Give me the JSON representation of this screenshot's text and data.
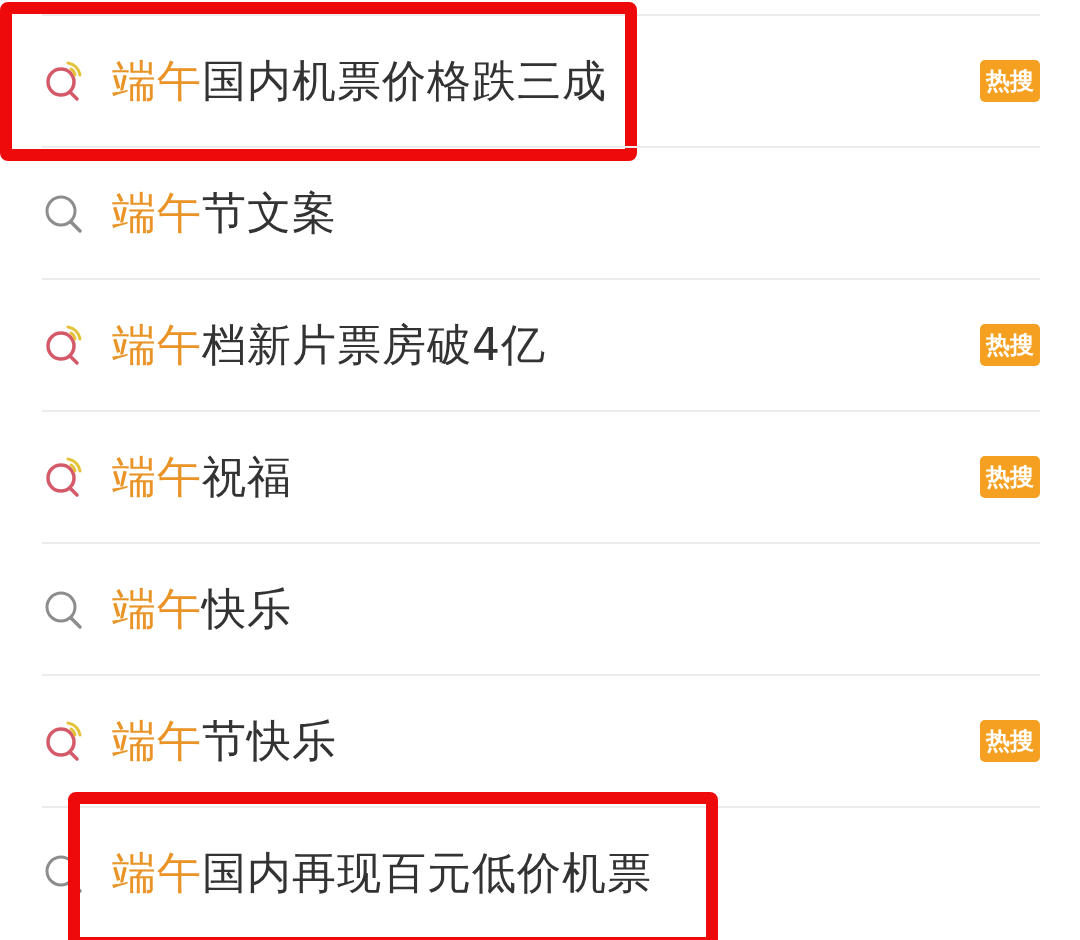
{
  "suggestions": [
    {
      "kind": "hot",
      "match": "端午",
      "rest": "国内机票价格跌三成",
      "badge": "热搜",
      "highlighted": true,
      "frame_covers_icon": true
    },
    {
      "kind": "plain",
      "match": "端午",
      "rest": "节文案"
    },
    {
      "kind": "hot",
      "match": "端午",
      "rest": "档新片票房破4亿",
      "badge": "热搜"
    },
    {
      "kind": "hot",
      "match": "端午",
      "rest": "祝福",
      "badge": "热搜"
    },
    {
      "kind": "plain",
      "match": "端午",
      "rest": "快乐"
    },
    {
      "kind": "hot",
      "match": "端午",
      "rest": "节快乐",
      "badge": "热搜"
    },
    {
      "kind": "plain",
      "match": "端午",
      "rest": "国内再现百元低价机票",
      "highlighted": true,
      "frame_covers_icon": false
    }
  ]
}
